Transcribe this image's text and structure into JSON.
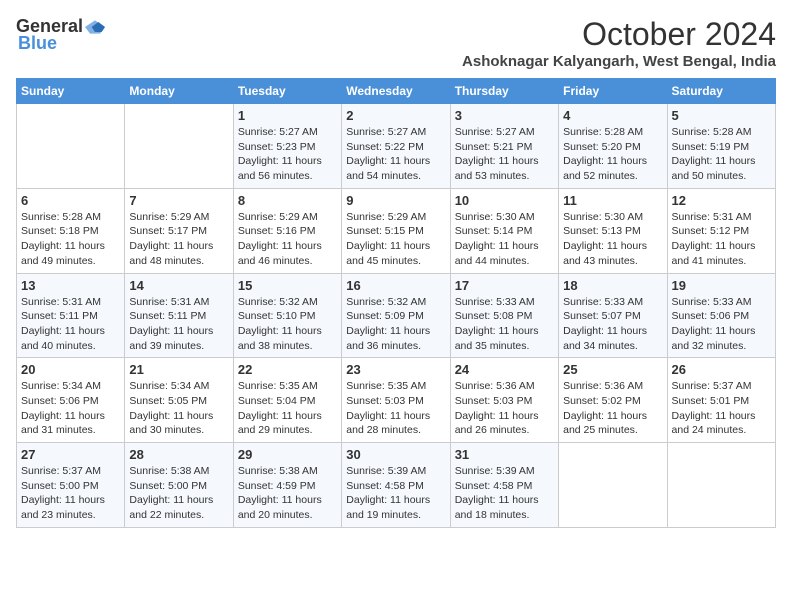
{
  "logo": {
    "general": "General",
    "blue": "Blue"
  },
  "title": "October 2024",
  "location": "Ashoknagar Kalyangarh, West Bengal, India",
  "headers": [
    "Sunday",
    "Monday",
    "Tuesday",
    "Wednesday",
    "Thursday",
    "Friday",
    "Saturday"
  ],
  "weeks": [
    [
      {
        "day": "",
        "sunrise": "",
        "sunset": "",
        "daylight": ""
      },
      {
        "day": "",
        "sunrise": "",
        "sunset": "",
        "daylight": ""
      },
      {
        "day": "1",
        "sunrise": "Sunrise: 5:27 AM",
        "sunset": "Sunset: 5:23 PM",
        "daylight": "Daylight: 11 hours and 56 minutes."
      },
      {
        "day": "2",
        "sunrise": "Sunrise: 5:27 AM",
        "sunset": "Sunset: 5:22 PM",
        "daylight": "Daylight: 11 hours and 54 minutes."
      },
      {
        "day": "3",
        "sunrise": "Sunrise: 5:27 AM",
        "sunset": "Sunset: 5:21 PM",
        "daylight": "Daylight: 11 hours and 53 minutes."
      },
      {
        "day": "4",
        "sunrise": "Sunrise: 5:28 AM",
        "sunset": "Sunset: 5:20 PM",
        "daylight": "Daylight: 11 hours and 52 minutes."
      },
      {
        "day": "5",
        "sunrise": "Sunrise: 5:28 AM",
        "sunset": "Sunset: 5:19 PM",
        "daylight": "Daylight: 11 hours and 50 minutes."
      }
    ],
    [
      {
        "day": "6",
        "sunrise": "Sunrise: 5:28 AM",
        "sunset": "Sunset: 5:18 PM",
        "daylight": "Daylight: 11 hours and 49 minutes."
      },
      {
        "day": "7",
        "sunrise": "Sunrise: 5:29 AM",
        "sunset": "Sunset: 5:17 PM",
        "daylight": "Daylight: 11 hours and 48 minutes."
      },
      {
        "day": "8",
        "sunrise": "Sunrise: 5:29 AM",
        "sunset": "Sunset: 5:16 PM",
        "daylight": "Daylight: 11 hours and 46 minutes."
      },
      {
        "day": "9",
        "sunrise": "Sunrise: 5:29 AM",
        "sunset": "Sunset: 5:15 PM",
        "daylight": "Daylight: 11 hours and 45 minutes."
      },
      {
        "day": "10",
        "sunrise": "Sunrise: 5:30 AM",
        "sunset": "Sunset: 5:14 PM",
        "daylight": "Daylight: 11 hours and 44 minutes."
      },
      {
        "day": "11",
        "sunrise": "Sunrise: 5:30 AM",
        "sunset": "Sunset: 5:13 PM",
        "daylight": "Daylight: 11 hours and 43 minutes."
      },
      {
        "day": "12",
        "sunrise": "Sunrise: 5:31 AM",
        "sunset": "Sunset: 5:12 PM",
        "daylight": "Daylight: 11 hours and 41 minutes."
      }
    ],
    [
      {
        "day": "13",
        "sunrise": "Sunrise: 5:31 AM",
        "sunset": "Sunset: 5:11 PM",
        "daylight": "Daylight: 11 hours and 40 minutes."
      },
      {
        "day": "14",
        "sunrise": "Sunrise: 5:31 AM",
        "sunset": "Sunset: 5:11 PM",
        "daylight": "Daylight: 11 hours and 39 minutes."
      },
      {
        "day": "15",
        "sunrise": "Sunrise: 5:32 AM",
        "sunset": "Sunset: 5:10 PM",
        "daylight": "Daylight: 11 hours and 38 minutes."
      },
      {
        "day": "16",
        "sunrise": "Sunrise: 5:32 AM",
        "sunset": "Sunset: 5:09 PM",
        "daylight": "Daylight: 11 hours and 36 minutes."
      },
      {
        "day": "17",
        "sunrise": "Sunrise: 5:33 AM",
        "sunset": "Sunset: 5:08 PM",
        "daylight": "Daylight: 11 hours and 35 minutes."
      },
      {
        "day": "18",
        "sunrise": "Sunrise: 5:33 AM",
        "sunset": "Sunset: 5:07 PM",
        "daylight": "Daylight: 11 hours and 34 minutes."
      },
      {
        "day": "19",
        "sunrise": "Sunrise: 5:33 AM",
        "sunset": "Sunset: 5:06 PM",
        "daylight": "Daylight: 11 hours and 32 minutes."
      }
    ],
    [
      {
        "day": "20",
        "sunrise": "Sunrise: 5:34 AM",
        "sunset": "Sunset: 5:06 PM",
        "daylight": "Daylight: 11 hours and 31 minutes."
      },
      {
        "day": "21",
        "sunrise": "Sunrise: 5:34 AM",
        "sunset": "Sunset: 5:05 PM",
        "daylight": "Daylight: 11 hours and 30 minutes."
      },
      {
        "day": "22",
        "sunrise": "Sunrise: 5:35 AM",
        "sunset": "Sunset: 5:04 PM",
        "daylight": "Daylight: 11 hours and 29 minutes."
      },
      {
        "day": "23",
        "sunrise": "Sunrise: 5:35 AM",
        "sunset": "Sunset: 5:03 PM",
        "daylight": "Daylight: 11 hours and 28 minutes."
      },
      {
        "day": "24",
        "sunrise": "Sunrise: 5:36 AM",
        "sunset": "Sunset: 5:03 PM",
        "daylight": "Daylight: 11 hours and 26 minutes."
      },
      {
        "day": "25",
        "sunrise": "Sunrise: 5:36 AM",
        "sunset": "Sunset: 5:02 PM",
        "daylight": "Daylight: 11 hours and 25 minutes."
      },
      {
        "day": "26",
        "sunrise": "Sunrise: 5:37 AM",
        "sunset": "Sunset: 5:01 PM",
        "daylight": "Daylight: 11 hours and 24 minutes."
      }
    ],
    [
      {
        "day": "27",
        "sunrise": "Sunrise: 5:37 AM",
        "sunset": "Sunset: 5:00 PM",
        "daylight": "Daylight: 11 hours and 23 minutes."
      },
      {
        "day": "28",
        "sunrise": "Sunrise: 5:38 AM",
        "sunset": "Sunset: 5:00 PM",
        "daylight": "Daylight: 11 hours and 22 minutes."
      },
      {
        "day": "29",
        "sunrise": "Sunrise: 5:38 AM",
        "sunset": "Sunset: 4:59 PM",
        "daylight": "Daylight: 11 hours and 20 minutes."
      },
      {
        "day": "30",
        "sunrise": "Sunrise: 5:39 AM",
        "sunset": "Sunset: 4:58 PM",
        "daylight": "Daylight: 11 hours and 19 minutes."
      },
      {
        "day": "31",
        "sunrise": "Sunrise: 5:39 AM",
        "sunset": "Sunset: 4:58 PM",
        "daylight": "Daylight: 11 hours and 18 minutes."
      },
      {
        "day": "",
        "sunrise": "",
        "sunset": "",
        "daylight": ""
      },
      {
        "day": "",
        "sunrise": "",
        "sunset": "",
        "daylight": ""
      }
    ]
  ]
}
